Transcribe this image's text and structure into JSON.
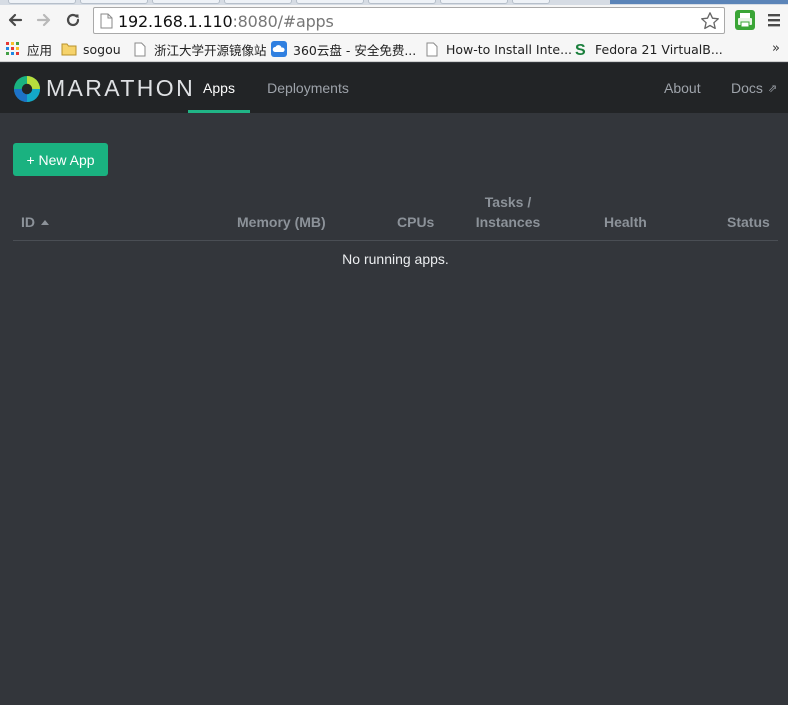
{
  "browser": {
    "url_host": "192.168.1.110",
    "url_rest": ":8080/#apps",
    "bookmarks": [
      {
        "label": "应用",
        "icon": "apps-grid-icon"
      },
      {
        "label": "sogou",
        "icon": "folder-icon"
      },
      {
        "label": "浙江大学开源镜像站",
        "icon": "page-icon"
      },
      {
        "label": "360云盘 - 安全免费...",
        "icon": "cloud-icon"
      },
      {
        "label": "How-to Install Inte...",
        "icon": "page-icon"
      },
      {
        "label": "Fedora 21 VirtualB...",
        "icon": "s-logo-icon"
      }
    ],
    "more_label": "»"
  },
  "navbar": {
    "brand": "MARATHON",
    "tabs": [
      {
        "label": "Apps",
        "active": true
      },
      {
        "label": "Deployments",
        "active": false
      }
    ],
    "about": "About",
    "docs": "Docs",
    "docs_icon": "⇗"
  },
  "main": {
    "new_app_button": "+ New App",
    "table": {
      "columns": {
        "id": "ID",
        "memory": "Memory (MB)",
        "cpus": "CPUs",
        "tasks_line1": "Tasks /",
        "tasks_line2": "Instances",
        "health": "Health",
        "status": "Status"
      },
      "empty_message": "No running apps."
    }
  },
  "colors": {
    "accent": "#20b586",
    "button": "#1ab280",
    "background": "#33363b",
    "navbar": "#222426"
  }
}
